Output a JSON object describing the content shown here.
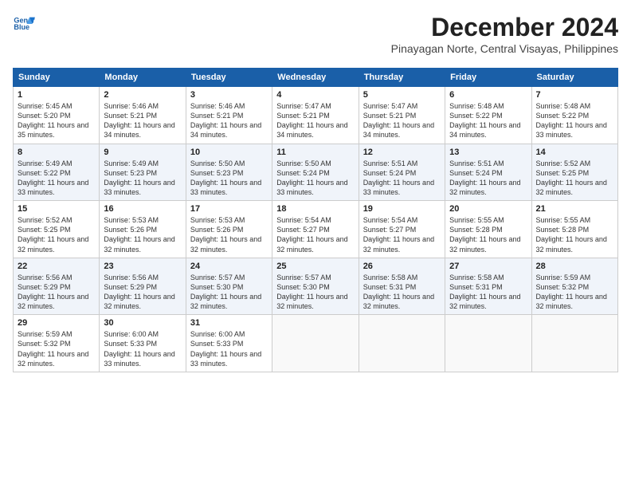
{
  "header": {
    "logo_line1": "General",
    "logo_line2": "Blue",
    "title": "December 2024",
    "subtitle": "Pinayagan Norte, Central Visayas, Philippines"
  },
  "columns": [
    "Sunday",
    "Monday",
    "Tuesday",
    "Wednesday",
    "Thursday",
    "Friday",
    "Saturday"
  ],
  "weeks": [
    [
      {
        "day": "1",
        "sunrise": "Sunrise: 5:45 AM",
        "sunset": "Sunset: 5:20 PM",
        "daylight": "Daylight: 11 hours and 35 minutes."
      },
      {
        "day": "2",
        "sunrise": "Sunrise: 5:46 AM",
        "sunset": "Sunset: 5:21 PM",
        "daylight": "Daylight: 11 hours and 34 minutes."
      },
      {
        "day": "3",
        "sunrise": "Sunrise: 5:46 AM",
        "sunset": "Sunset: 5:21 PM",
        "daylight": "Daylight: 11 hours and 34 minutes."
      },
      {
        "day": "4",
        "sunrise": "Sunrise: 5:47 AM",
        "sunset": "Sunset: 5:21 PM",
        "daylight": "Daylight: 11 hours and 34 minutes."
      },
      {
        "day": "5",
        "sunrise": "Sunrise: 5:47 AM",
        "sunset": "Sunset: 5:21 PM",
        "daylight": "Daylight: 11 hours and 34 minutes."
      },
      {
        "day": "6",
        "sunrise": "Sunrise: 5:48 AM",
        "sunset": "Sunset: 5:22 PM",
        "daylight": "Daylight: 11 hours and 34 minutes."
      },
      {
        "day": "7",
        "sunrise": "Sunrise: 5:48 AM",
        "sunset": "Sunset: 5:22 PM",
        "daylight": "Daylight: 11 hours and 33 minutes."
      }
    ],
    [
      {
        "day": "8",
        "sunrise": "Sunrise: 5:49 AM",
        "sunset": "Sunset: 5:22 PM",
        "daylight": "Daylight: 11 hours and 33 minutes."
      },
      {
        "day": "9",
        "sunrise": "Sunrise: 5:49 AM",
        "sunset": "Sunset: 5:23 PM",
        "daylight": "Daylight: 11 hours and 33 minutes."
      },
      {
        "day": "10",
        "sunrise": "Sunrise: 5:50 AM",
        "sunset": "Sunset: 5:23 PM",
        "daylight": "Daylight: 11 hours and 33 minutes."
      },
      {
        "day": "11",
        "sunrise": "Sunrise: 5:50 AM",
        "sunset": "Sunset: 5:24 PM",
        "daylight": "Daylight: 11 hours and 33 minutes."
      },
      {
        "day": "12",
        "sunrise": "Sunrise: 5:51 AM",
        "sunset": "Sunset: 5:24 PM",
        "daylight": "Daylight: 11 hours and 33 minutes."
      },
      {
        "day": "13",
        "sunrise": "Sunrise: 5:51 AM",
        "sunset": "Sunset: 5:24 PM",
        "daylight": "Daylight: 11 hours and 32 minutes."
      },
      {
        "day": "14",
        "sunrise": "Sunrise: 5:52 AM",
        "sunset": "Sunset: 5:25 PM",
        "daylight": "Daylight: 11 hours and 32 minutes."
      }
    ],
    [
      {
        "day": "15",
        "sunrise": "Sunrise: 5:52 AM",
        "sunset": "Sunset: 5:25 PM",
        "daylight": "Daylight: 11 hours and 32 minutes."
      },
      {
        "day": "16",
        "sunrise": "Sunrise: 5:53 AM",
        "sunset": "Sunset: 5:26 PM",
        "daylight": "Daylight: 11 hours and 32 minutes."
      },
      {
        "day": "17",
        "sunrise": "Sunrise: 5:53 AM",
        "sunset": "Sunset: 5:26 PM",
        "daylight": "Daylight: 11 hours and 32 minutes."
      },
      {
        "day": "18",
        "sunrise": "Sunrise: 5:54 AM",
        "sunset": "Sunset: 5:27 PM",
        "daylight": "Daylight: 11 hours and 32 minutes."
      },
      {
        "day": "19",
        "sunrise": "Sunrise: 5:54 AM",
        "sunset": "Sunset: 5:27 PM",
        "daylight": "Daylight: 11 hours and 32 minutes."
      },
      {
        "day": "20",
        "sunrise": "Sunrise: 5:55 AM",
        "sunset": "Sunset: 5:28 PM",
        "daylight": "Daylight: 11 hours and 32 minutes."
      },
      {
        "day": "21",
        "sunrise": "Sunrise: 5:55 AM",
        "sunset": "Sunset: 5:28 PM",
        "daylight": "Daylight: 11 hours and 32 minutes."
      }
    ],
    [
      {
        "day": "22",
        "sunrise": "Sunrise: 5:56 AM",
        "sunset": "Sunset: 5:29 PM",
        "daylight": "Daylight: 11 hours and 32 minutes."
      },
      {
        "day": "23",
        "sunrise": "Sunrise: 5:56 AM",
        "sunset": "Sunset: 5:29 PM",
        "daylight": "Daylight: 11 hours and 32 minutes."
      },
      {
        "day": "24",
        "sunrise": "Sunrise: 5:57 AM",
        "sunset": "Sunset: 5:30 PM",
        "daylight": "Daylight: 11 hours and 32 minutes."
      },
      {
        "day": "25",
        "sunrise": "Sunrise: 5:57 AM",
        "sunset": "Sunset: 5:30 PM",
        "daylight": "Daylight: 11 hours and 32 minutes."
      },
      {
        "day": "26",
        "sunrise": "Sunrise: 5:58 AM",
        "sunset": "Sunset: 5:31 PM",
        "daylight": "Daylight: 11 hours and 32 minutes."
      },
      {
        "day": "27",
        "sunrise": "Sunrise: 5:58 AM",
        "sunset": "Sunset: 5:31 PM",
        "daylight": "Daylight: 11 hours and 32 minutes."
      },
      {
        "day": "28",
        "sunrise": "Sunrise: 5:59 AM",
        "sunset": "Sunset: 5:32 PM",
        "daylight": "Daylight: 11 hours and 32 minutes."
      }
    ],
    [
      {
        "day": "29",
        "sunrise": "Sunrise: 5:59 AM",
        "sunset": "Sunset: 5:32 PM",
        "daylight": "Daylight: 11 hours and 32 minutes."
      },
      {
        "day": "30",
        "sunrise": "Sunrise: 6:00 AM",
        "sunset": "Sunset: 5:33 PM",
        "daylight": "Daylight: 11 hours and 33 minutes."
      },
      {
        "day": "31",
        "sunrise": "Sunrise: 6:00 AM",
        "sunset": "Sunset: 5:33 PM",
        "daylight": "Daylight: 11 hours and 33 minutes."
      },
      null,
      null,
      null,
      null
    ]
  ]
}
